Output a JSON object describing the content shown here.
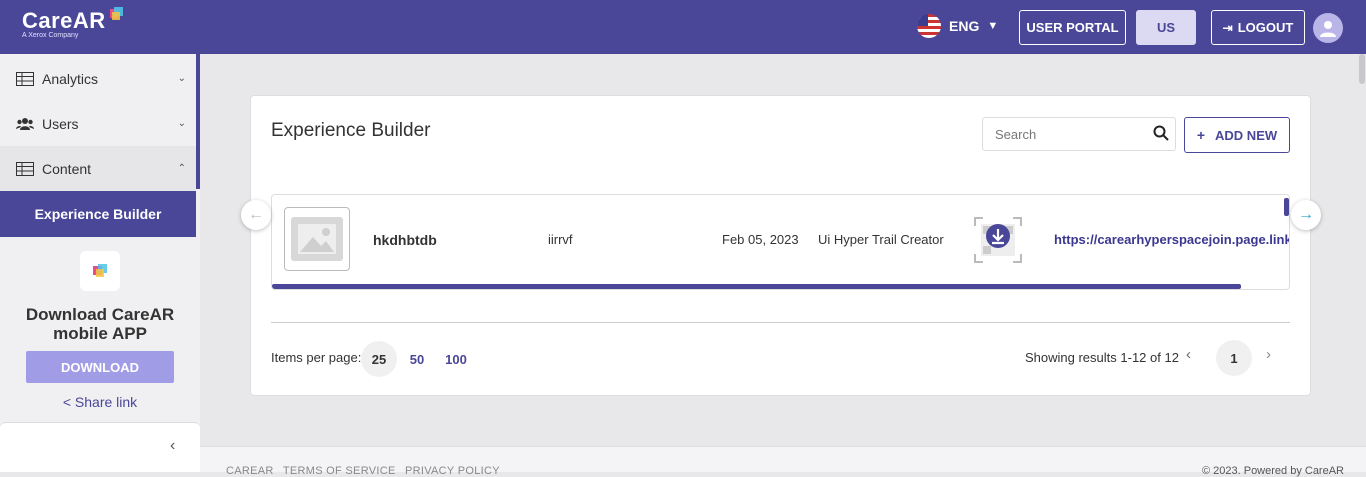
{
  "header": {
    "logo_text": "CareAR",
    "logo_tagline": "A Xerox Company",
    "language": "ENG",
    "user_portal_label": "USER PORTAL",
    "us_label": "US",
    "logout_label": "LOGOUT",
    "brand_color": "#4a4799"
  },
  "sidebar": {
    "items": [
      {
        "label": "Analytics",
        "icon": "table-icon",
        "expanded": false
      },
      {
        "label": "Users",
        "icon": "users-icon",
        "expanded": false
      },
      {
        "label": "Content",
        "icon": "table-icon",
        "expanded": true
      }
    ],
    "active_item": "Experience Builder",
    "download_title": "Download CareAR mobile APP",
    "download_button": "DOWNLOAD",
    "share_link": "Share link"
  },
  "main": {
    "title": "Experience Builder",
    "search_placeholder": "Search",
    "add_new_label": "ADD NEW",
    "rows": [
      {
        "name": "hkdhbtdb",
        "description": "iirrvf",
        "date": "Feb 05, 2023",
        "creator": "Ui Hyper Trail Creator",
        "link": "https://carearhyperspacejoin.page.link/"
      }
    ],
    "pagination": {
      "items_per_page_label": "Items per page:",
      "options": [
        "25",
        "50",
        "100"
      ],
      "selected": "25",
      "showing": "Showing results 1-12 of 12",
      "current_page": "1"
    }
  },
  "footer": {
    "links": [
      "CAREAR",
      "TERMS OF SERVICE",
      "PRIVACY POLICY"
    ],
    "copyright": "© 2023. Powered by CareAR"
  }
}
